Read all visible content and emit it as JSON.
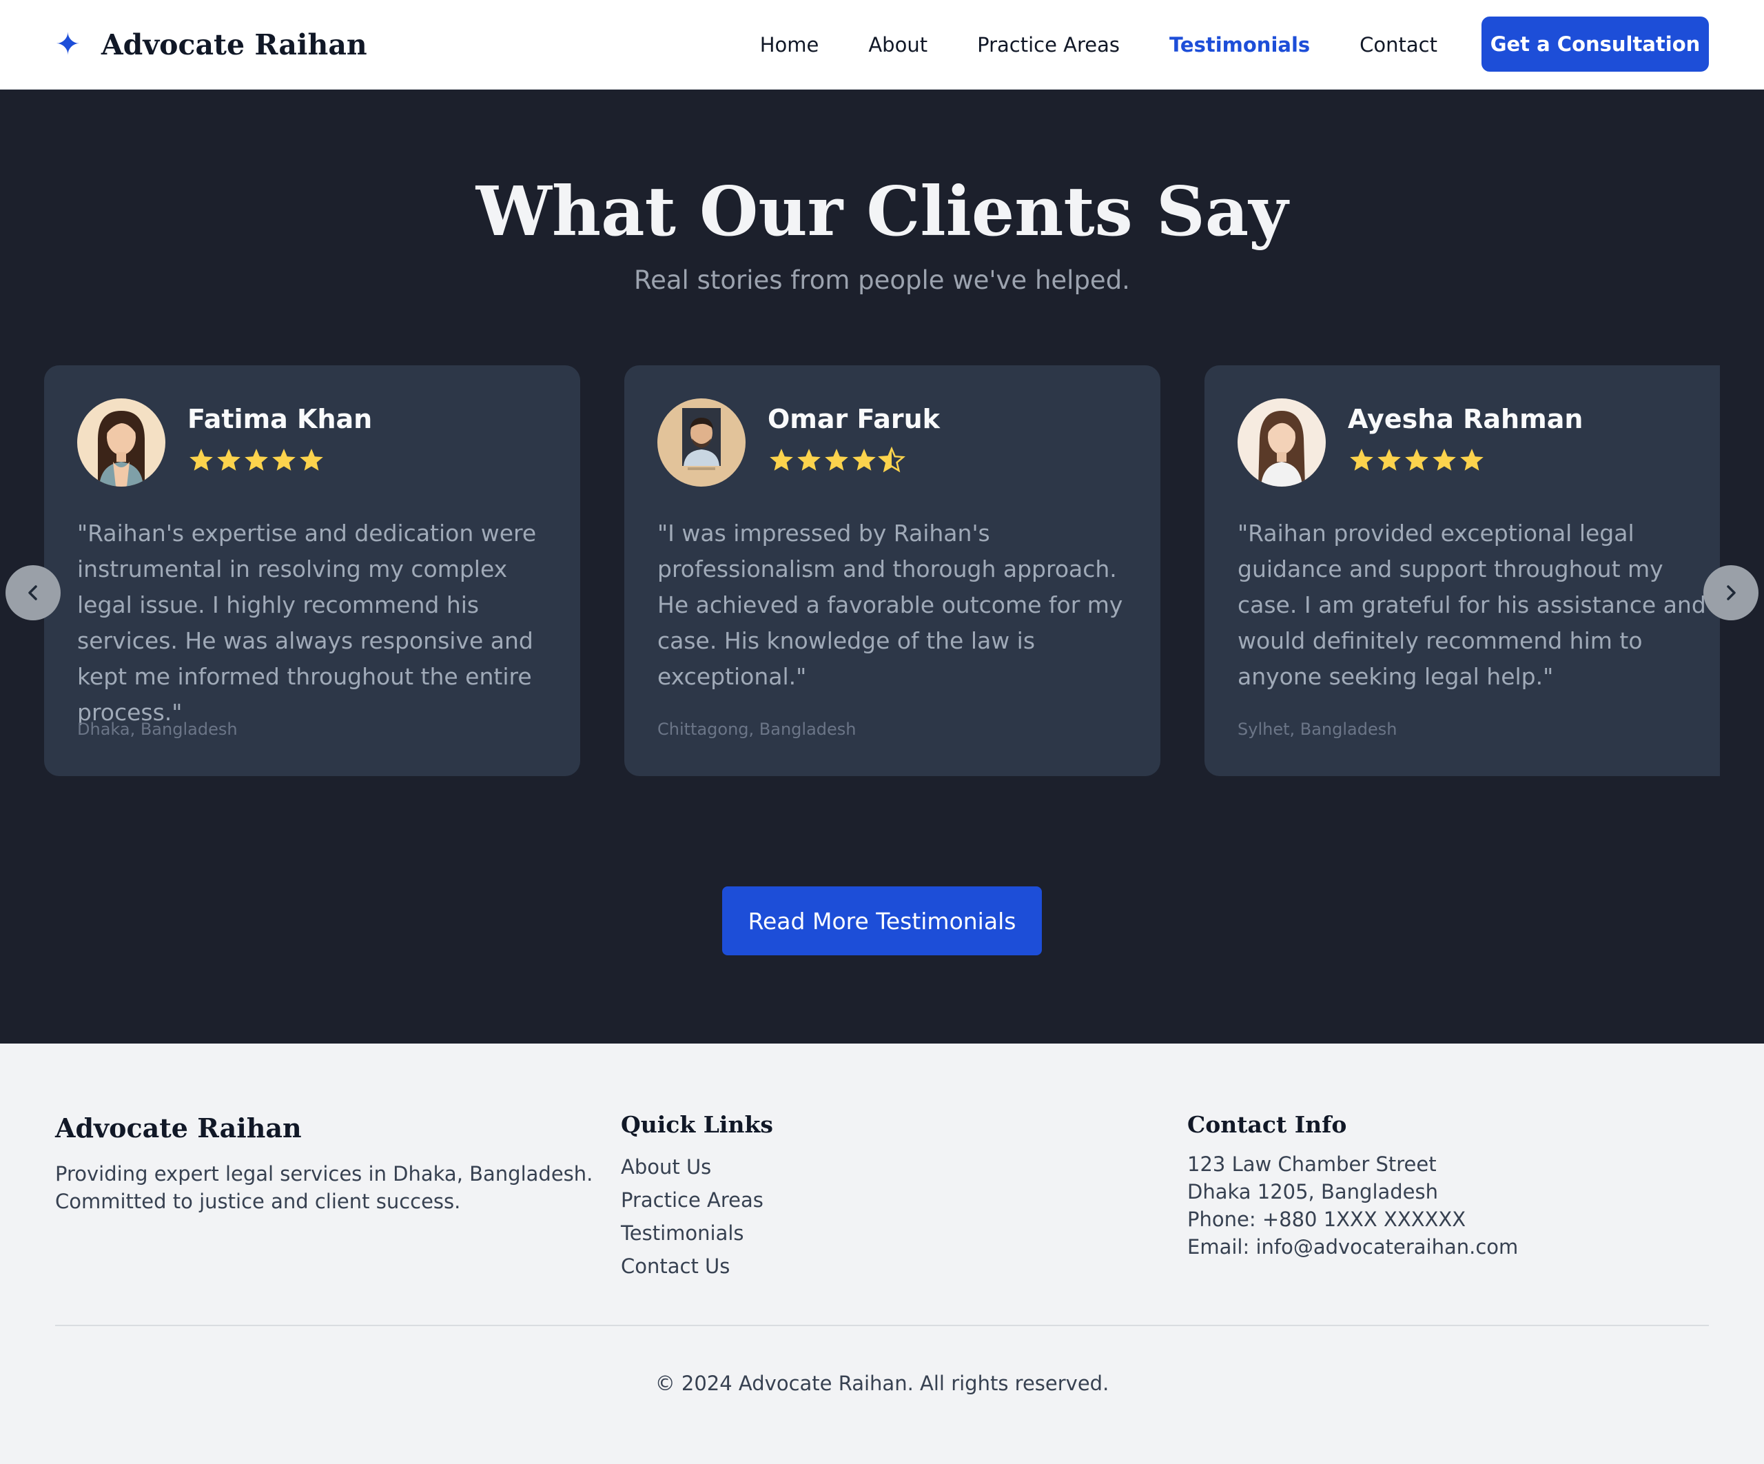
{
  "nav": {
    "brand_name": "Advocate Raihan",
    "brand_icon": "sparkle-icon",
    "links": [
      "Home",
      "About",
      "Practice Areas",
      "Testimonials",
      "Contact"
    ],
    "active_link": "Testimonials",
    "cta_label": "Get a Consultation",
    "accent_color": "#1d4ed8"
  },
  "testimonials": {
    "title": "What Our Clients Say",
    "subtitle": "Real stories from people we've helped.",
    "prev_icon": "chevron-left-icon",
    "next_icon": "chevron-right-icon",
    "cards": [
      {
        "name": "Fatima Khan",
        "rating": 5,
        "quote": "\"Raihan's expertise and dedication were instrumental in resolving my complex legal issue. I highly recommend his services. He was always responsive and kept me informed throughout the entire process.\"",
        "location": "Dhaka, Bangladesh"
      },
      {
        "name": "Omar Faruk",
        "rating": 4.5,
        "quote": "\"I was impressed by Raihan's professionalism and thorough approach. He achieved a favorable outcome for my case. His knowledge of the law is exceptional.\"",
        "location": "Chittagong, Bangladesh"
      },
      {
        "name": "Ayesha Rahman",
        "rating": 5,
        "quote": "\"Raihan provided exceptional legal guidance and support throughout my case. I am grateful for his assistance and would definitely recommend him to anyone seeking legal help.\"",
        "location": "Sylhet, Bangladesh"
      }
    ],
    "read_more_label": "Read More Testimonials",
    "star_color": "#fcd34d"
  },
  "footer": {
    "about": {
      "title": "Advocate Raihan",
      "lines": [
        "Providing expert legal services in Dhaka, Bangladesh.",
        "Committed to justice and client success."
      ]
    },
    "quick_links": {
      "title": "Quick Links",
      "links": [
        "About Us",
        "Practice Areas",
        "Testimonials",
        "Contact Us"
      ]
    },
    "contact": {
      "title": "Contact Info",
      "lines": [
        "123 Law Chamber Street",
        "Dhaka 1205, Bangladesh",
        "Phone: +880 1XXX XXXXXX",
        "Email: info@advocateraihan.com"
      ]
    },
    "copyright": "© 2024 Advocate Raihan. All rights reserved."
  }
}
